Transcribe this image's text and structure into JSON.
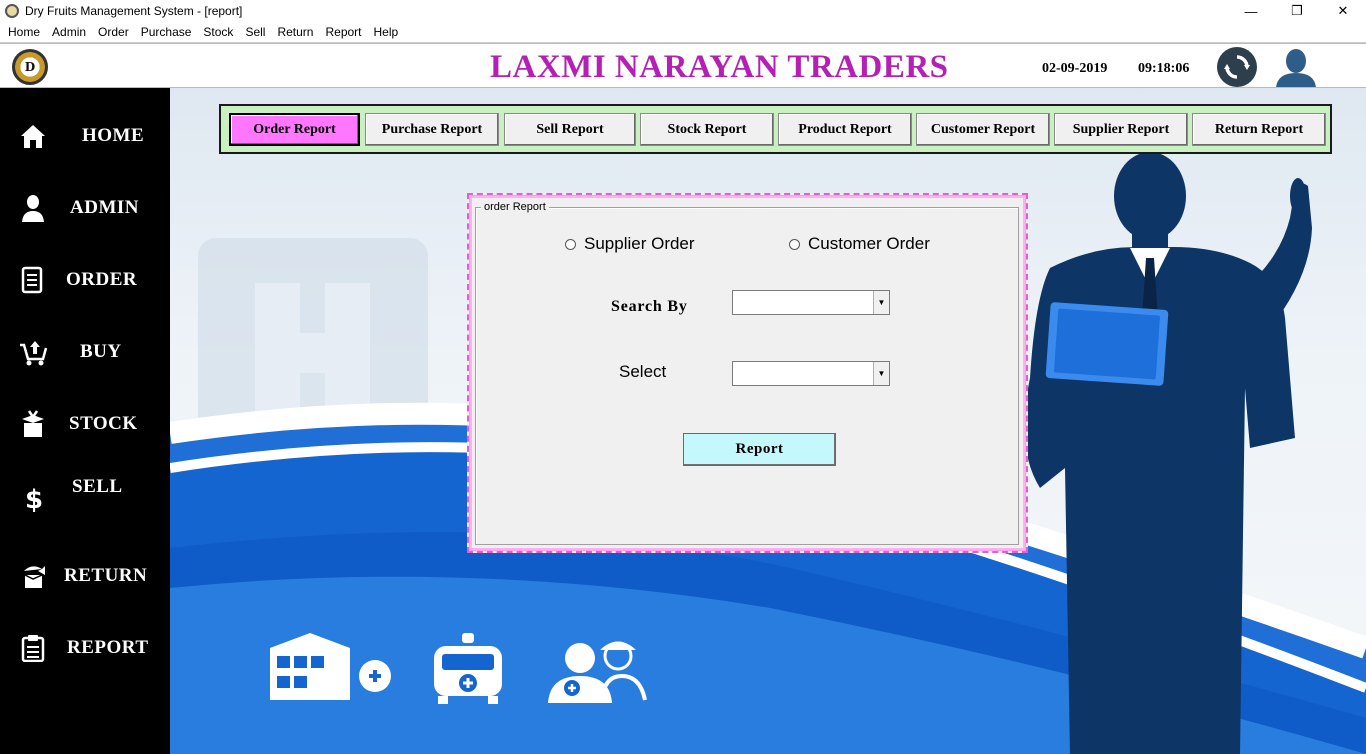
{
  "window": {
    "title": "Dry Fruits Management System - [report]",
    "minimize_glyph": "—",
    "restore_glyph": "❐",
    "close_glyph": "✕"
  },
  "menu": [
    "Home",
    "Admin",
    "Order",
    "Purchase",
    "Stock",
    "Sell",
    "Return",
    "Report",
    "Help"
  ],
  "header": {
    "logo_text": "D",
    "company": "LAXMI NARAYAN TRADERS",
    "date": "02-09-2019",
    "time": "09:18:06"
  },
  "sidebar": {
    "items": [
      {
        "label": "HOME",
        "icon": "home-icon"
      },
      {
        "label": "ADMIN",
        "icon": "user-icon"
      },
      {
        "label": "ORDER",
        "icon": "document-icon"
      },
      {
        "label": "BUY",
        "icon": "cart-icon"
      },
      {
        "label": "STOCK",
        "icon": "box-icon"
      },
      {
        "label": "SELL",
        "icon": "dollar-icon"
      },
      {
        "label": "RETURN",
        "icon": "return-icon"
      },
      {
        "label": "REPORT",
        "icon": "clipboard-icon"
      }
    ]
  },
  "tabs": [
    {
      "label": "Order  Report",
      "active": true
    },
    {
      "label": "Purchase  Report",
      "active": false
    },
    {
      "label": "Sell Report",
      "active": false
    },
    {
      "label": "Stock  Report",
      "active": false
    },
    {
      "label": "Product  Report",
      "active": false
    },
    {
      "label": "Customer Report",
      "active": false
    },
    {
      "label": "Supplier  Report",
      "active": false
    },
    {
      "label": "Return  Report",
      "active": false
    }
  ],
  "panel": {
    "group_title": "order Report",
    "radio_supplier": "Supplier Order",
    "radio_customer": "Customer Order",
    "search_by_label": "Search By",
    "search_by_value": "",
    "select_label": "Select",
    "select_value": "",
    "report_button": "Report"
  },
  "colors": {
    "company": "#b51fb5",
    "active_tab": "#ff77ff",
    "tabbar_bg": "#c8f0c0",
    "report_button": "#c4f8fc",
    "sidebar_bg": "#000000"
  }
}
